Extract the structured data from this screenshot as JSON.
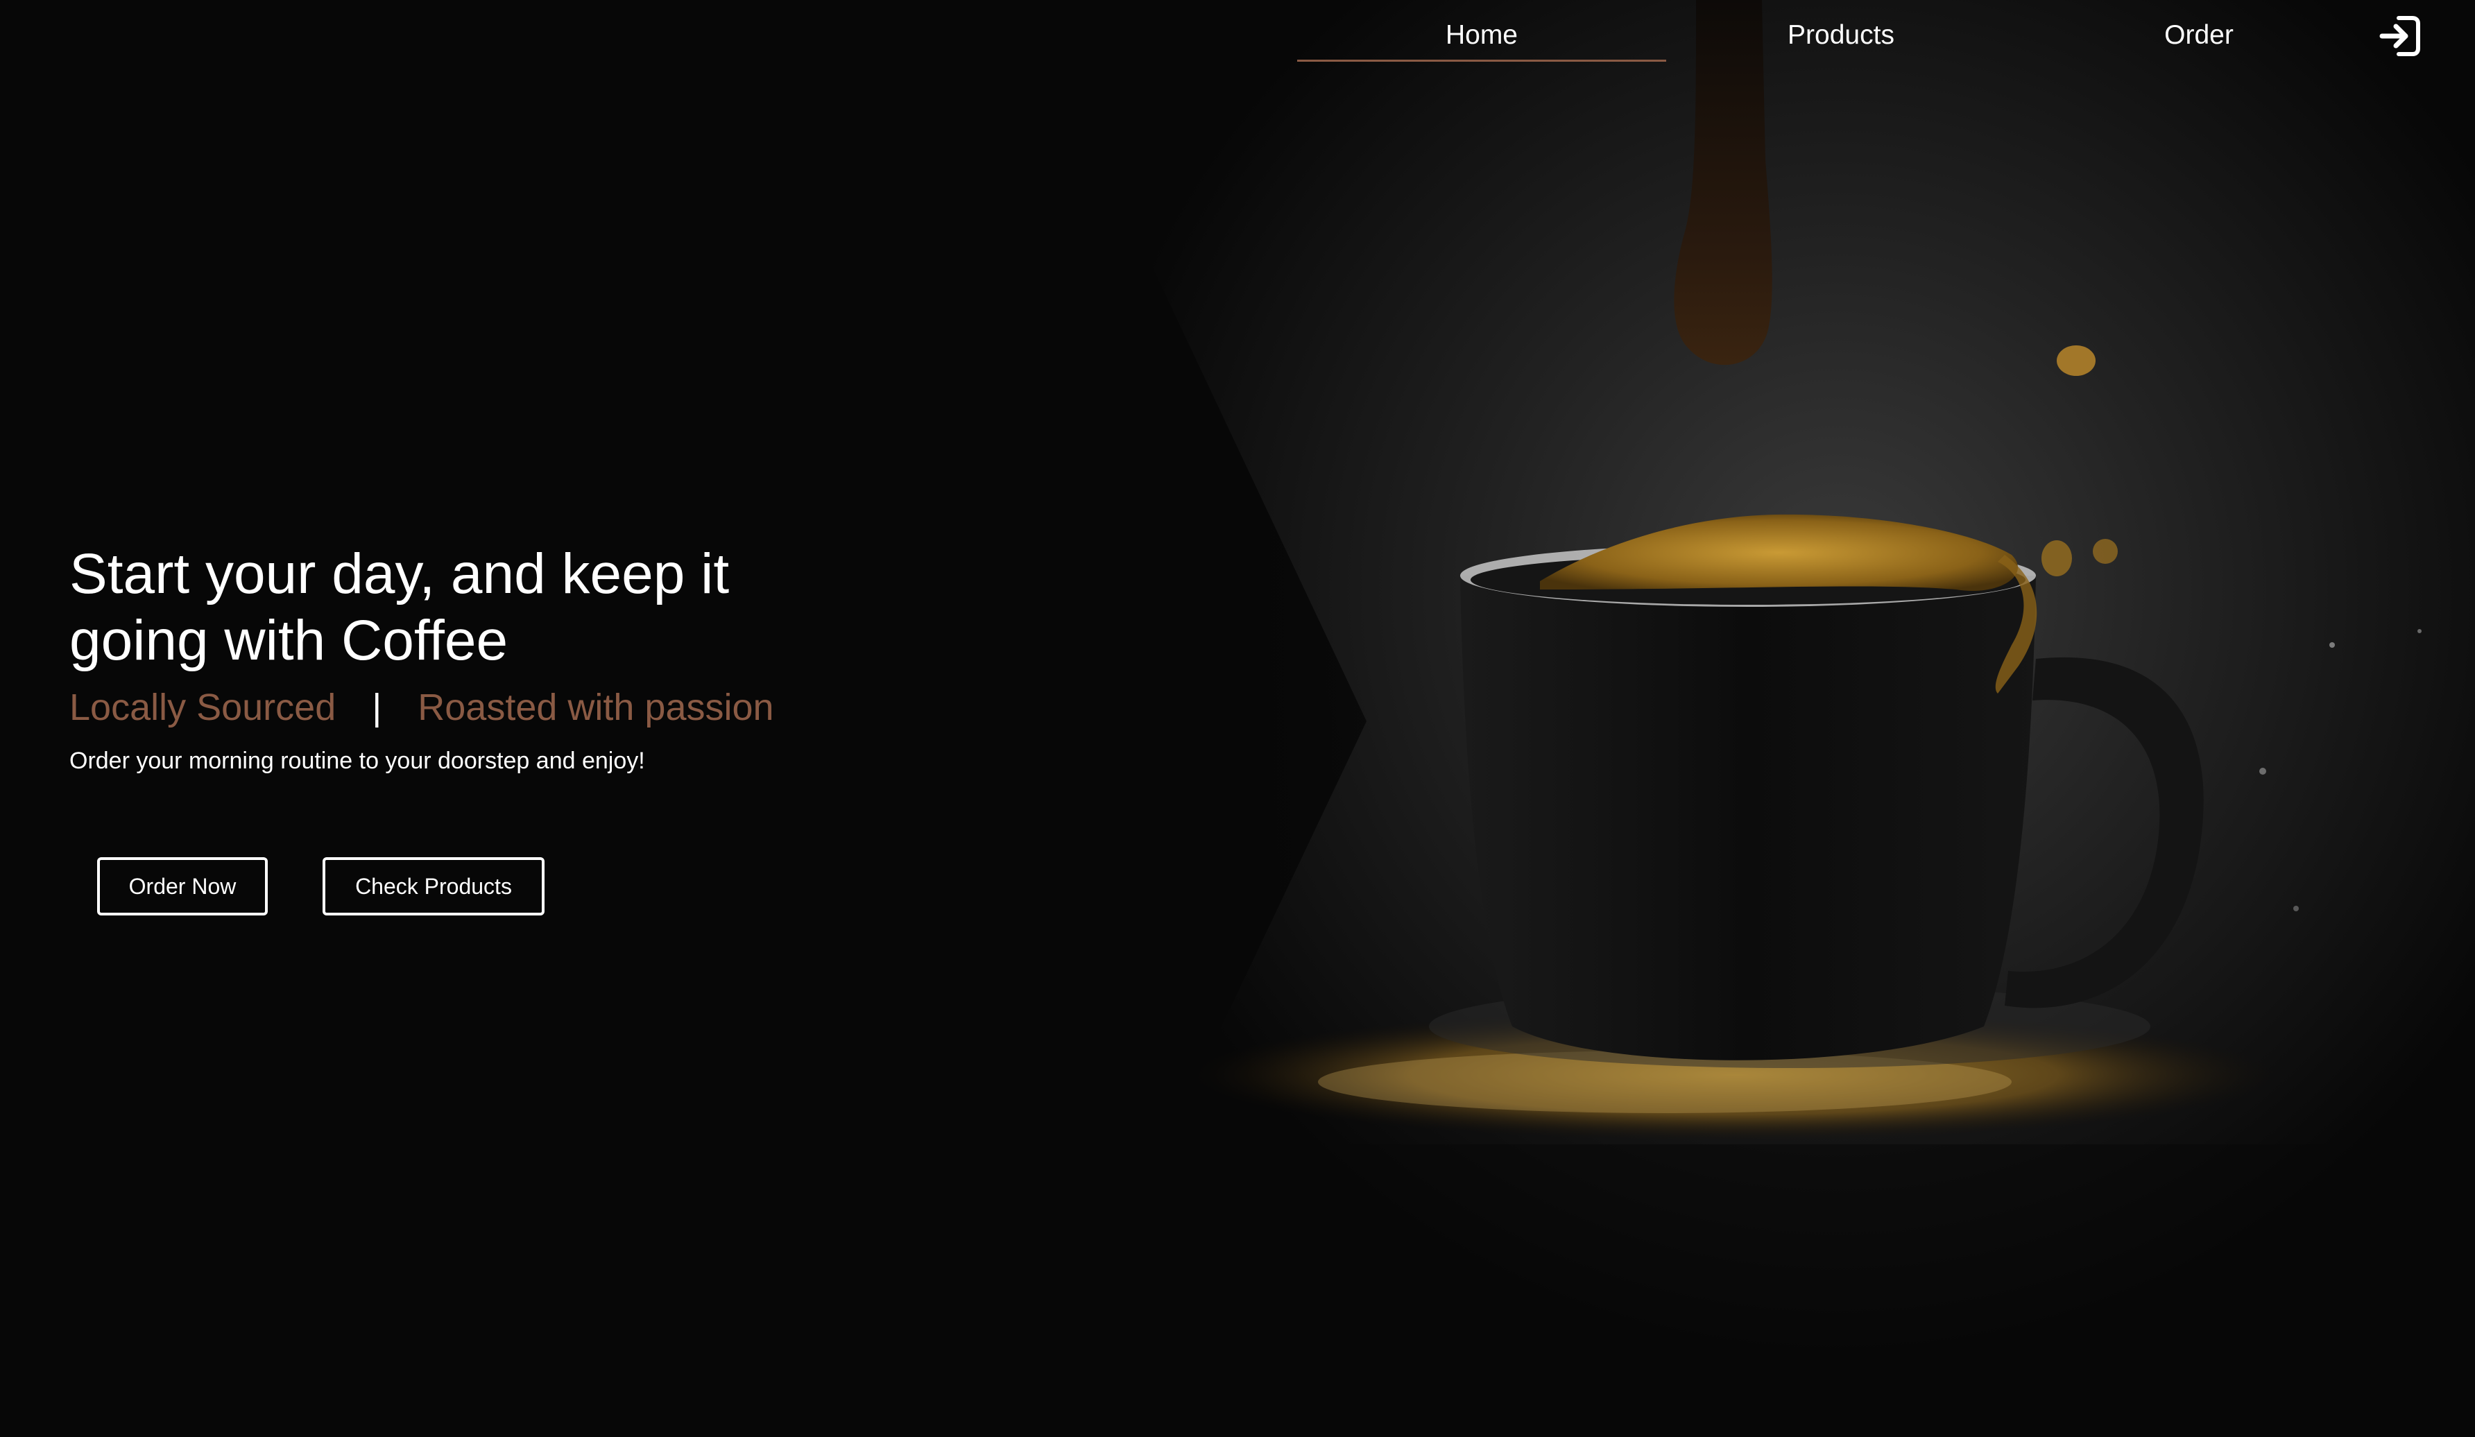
{
  "nav": {
    "items": [
      {
        "label": "Home",
        "active": true
      },
      {
        "label": "Products",
        "active": false
      },
      {
        "label": "Order",
        "active": false
      }
    ],
    "login_icon": "login-icon"
  },
  "hero": {
    "title": "Start your day, and keep it going with Coffee",
    "tagline_left": "Locally Sourced",
    "tagline_separator": "|",
    "tagline_right": "Roasted with passion",
    "subtext": "Order your morning routine to your doorstep and enjoy!",
    "order_button": "Order Now",
    "products_button": "Check Products"
  },
  "colors": {
    "accent": "#8a5a44",
    "background": "#070707",
    "text": "#ffffff",
    "coffee_foam": "#b88a2a"
  },
  "background_image": "coffee-cup-photo"
}
